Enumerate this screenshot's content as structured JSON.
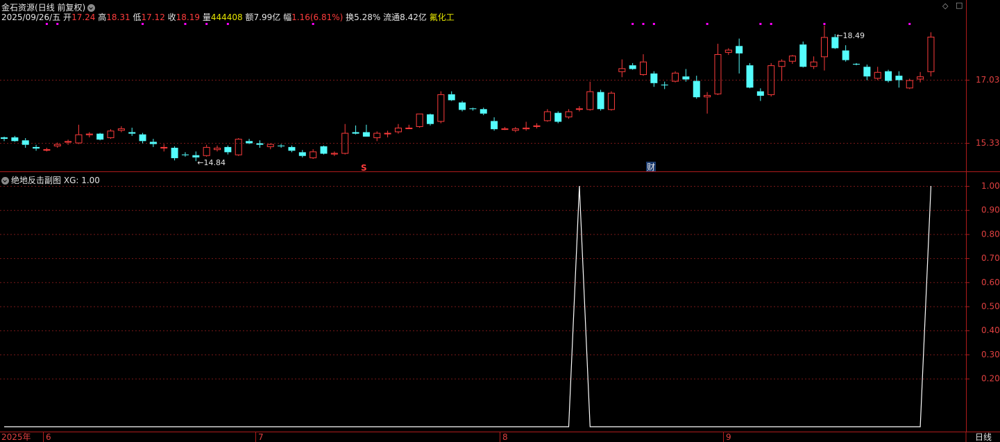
{
  "stock": {
    "name": "金石资源",
    "period": "(日线 前复权)",
    "date": "2025/09/26/五",
    "open_label": "开",
    "open": "17.24",
    "high_label": "高",
    "high": "18.31",
    "low_label": "低",
    "low": "17.12",
    "close_label": "收",
    "close": "18.19",
    "volume_label": "量",
    "volume": "444408",
    "amount_label": "额",
    "amount": "7.99亿",
    "change_label": "幅",
    "change": "1.16(6.81%)",
    "turnover_label": "换",
    "turnover": "5.28%",
    "float_label": "流通",
    "float": "8.42亿",
    "sector": "氟化工"
  },
  "window_buttons": {
    "diamond": "◇",
    "maximize": "□"
  },
  "indicator": {
    "name": "绝地反击副图",
    "xg_label": "XG: 1.00"
  },
  "markers": {
    "s_marker": "S",
    "cai_marker": "财"
  },
  "colors": {
    "up": "#ff3c3c",
    "down": "#54fcfc",
    "grid": "#7a1818",
    "axis": "#b01c1c",
    "indicator": "#ffffff",
    "dot": "#ff00ff"
  },
  "chart_data": [
    {
      "type": "candlestick",
      "grid": true,
      "y_ticks": [
        "17.03",
        "15.33"
      ],
      "x_ticks": [
        "2025年",
        "6",
        "7",
        "8",
        "9"
      ],
      "annotations": [
        {
          "text": "18.49",
          "candle_index": 78
        },
        {
          "text": "14.84",
          "candle_index": 18
        }
      ],
      "ohlc": [
        [
          15.48,
          15.5,
          15.38,
          15.44
        ],
        [
          15.48,
          15.52,
          15.36,
          15.38
        ],
        [
          15.4,
          15.46,
          15.2,
          15.28
        ],
        [
          15.22,
          15.28,
          15.12,
          15.18
        ],
        [
          15.14,
          15.2,
          15.1,
          15.16
        ],
        [
          15.24,
          15.34,
          15.2,
          15.3
        ],
        [
          15.34,
          15.42,
          15.28,
          15.38
        ],
        [
          15.32,
          15.82,
          15.3,
          15.56
        ],
        [
          15.54,
          15.62,
          15.48,
          15.58
        ],
        [
          15.58,
          15.6,
          15.4,
          15.42
        ],
        [
          15.46,
          15.7,
          15.44,
          15.66
        ],
        [
          15.66,
          15.78,
          15.62,
          15.72
        ],
        [
          15.62,
          15.74,
          15.52,
          15.58
        ],
        [
          15.56,
          15.6,
          15.32,
          15.38
        ],
        [
          15.36,
          15.44,
          15.22,
          15.3
        ],
        [
          15.22,
          15.3,
          15.1,
          15.22
        ],
        [
          15.2,
          15.24,
          14.86,
          14.92
        ],
        [
          15.02,
          15.08,
          14.96,
          15.0
        ],
        [
          15.0,
          15.1,
          14.84,
          14.94
        ],
        [
          14.98,
          15.28,
          14.96,
          15.22
        ],
        [
          15.14,
          15.26,
          15.1,
          15.2
        ],
        [
          15.22,
          15.26,
          15.02,
          15.08
        ],
        [
          15.0,
          15.46,
          14.98,
          15.44
        ],
        [
          15.38,
          15.44,
          15.3,
          15.32
        ],
        [
          15.32,
          15.4,
          15.2,
          15.28
        ],
        [
          15.22,
          15.32,
          15.16,
          15.3
        ],
        [
          15.26,
          15.3,
          15.2,
          15.24
        ],
        [
          15.22,
          15.26,
          15.08,
          15.12
        ],
        [
          15.08,
          15.14,
          14.94,
          14.98
        ],
        [
          14.92,
          15.16,
          14.9,
          15.1
        ],
        [
          15.24,
          15.26,
          15.02,
          15.04
        ],
        [
          15.02,
          15.1,
          14.98,
          15.06
        ],
        [
          15.04,
          15.84,
          15.02,
          15.6
        ],
        [
          15.62,
          15.8,
          15.56,
          15.58
        ],
        [
          15.62,
          15.82,
          15.5,
          15.5
        ],
        [
          15.46,
          15.64,
          15.38,
          15.6
        ],
        [
          15.58,
          15.66,
          15.48,
          15.6
        ],
        [
          15.62,
          15.84,
          15.58,
          15.74
        ],
        [
          15.74,
          15.82,
          15.72,
          15.74
        ],
        [
          15.76,
          16.12,
          15.74,
          16.12
        ],
        [
          16.1,
          16.12,
          15.8,
          15.84
        ],
        [
          15.9,
          16.72,
          15.86,
          16.64
        ],
        [
          16.64,
          16.72,
          16.46,
          16.48
        ],
        [
          16.42,
          16.46,
          16.18,
          16.22
        ],
        [
          16.26,
          16.28,
          16.2,
          16.24
        ],
        [
          16.24,
          16.28,
          16.08,
          16.12
        ],
        [
          15.92,
          16.02,
          15.66,
          15.7
        ],
        [
          15.7,
          15.76,
          15.68,
          15.72
        ],
        [
          15.66,
          15.76,
          15.62,
          15.72
        ],
        [
          15.7,
          15.9,
          15.66,
          15.74
        ],
        [
          15.78,
          15.86,
          15.72,
          15.8
        ],
        [
          15.92,
          16.24,
          15.9,
          16.18
        ],
        [
          16.14,
          16.18,
          15.86,
          15.9
        ],
        [
          16.02,
          16.24,
          15.98,
          16.18
        ],
        [
          16.24,
          16.32,
          16.18,
          16.26
        ],
        [
          16.22,
          16.98,
          16.2,
          16.72
        ],
        [
          16.7,
          16.76,
          16.2,
          16.24
        ],
        [
          16.22,
          16.72,
          16.2,
          16.68
        ],
        [
          17.24,
          17.58,
          17.1,
          17.34
        ],
        [
          17.42,
          17.48,
          17.3,
          17.32
        ],
        [
          17.16,
          17.72,
          17.14,
          17.52
        ],
        [
          17.2,
          17.26,
          16.84,
          16.94
        ],
        [
          16.9,
          16.98,
          16.78,
          16.88
        ],
        [
          16.98,
          17.26,
          16.96,
          17.22
        ],
        [
          17.12,
          17.32,
          16.98,
          17.04
        ],
        [
          17.0,
          17.14,
          16.52,
          16.56
        ],
        [
          16.56,
          16.7,
          16.12,
          16.62
        ],
        [
          16.64,
          18.0,
          16.62,
          17.72
        ],
        [
          17.76,
          17.88,
          17.7,
          17.84
        ],
        [
          17.94,
          18.14,
          17.2,
          17.74
        ],
        [
          17.42,
          17.48,
          16.8,
          16.82
        ],
        [
          16.72,
          16.8,
          16.46,
          16.6
        ],
        [
          16.62,
          17.48,
          16.58,
          17.42
        ],
        [
          17.38,
          17.58,
          17.0,
          17.54
        ],
        [
          17.52,
          17.7,
          17.46,
          17.68
        ],
        [
          17.98,
          18.06,
          17.36,
          17.38
        ],
        [
          17.38,
          17.66,
          17.32,
          17.52
        ],
        [
          17.64,
          18.49,
          17.28,
          18.18
        ],
        [
          18.18,
          18.26,
          17.86,
          17.88
        ],
        [
          17.82,
          17.96,
          17.52,
          17.56
        ],
        [
          17.46,
          17.48,
          17.42,
          17.44
        ],
        [
          17.38,
          17.44,
          17.02,
          17.12
        ],
        [
          17.06,
          17.38,
          17.02,
          17.24
        ],
        [
          17.26,
          17.3,
          16.96,
          17.0
        ],
        [
          17.14,
          17.26,
          16.82,
          17.02
        ],
        [
          16.8,
          17.06,
          16.78,
          17.02
        ],
        [
          17.04,
          17.24,
          16.96,
          17.12
        ],
        [
          17.24,
          18.31,
          17.12,
          18.19
        ]
      ]
    },
    {
      "type": "line",
      "series": [
        {
          "name": "XG",
          "values": [
            0,
            0,
            0,
            0,
            0,
            0,
            0,
            0,
            0,
            0,
            0,
            0,
            0,
            0,
            0,
            0,
            0,
            0,
            0,
            0,
            0,
            0,
            0,
            0,
            0,
            0,
            0,
            0,
            0,
            0,
            0,
            0,
            0,
            0,
            0,
            0,
            0,
            0,
            0,
            0,
            0,
            0,
            0,
            0,
            0,
            0,
            0,
            0,
            0,
            0,
            0,
            0,
            0,
            0,
            1,
            0,
            0,
            0,
            0,
            0,
            0,
            0,
            0,
            0,
            0,
            0,
            0,
            0,
            0,
            0,
            0,
            0,
            0,
            0,
            0,
            0,
            0,
            0,
            0,
            0,
            0,
            0,
            0,
            0,
            0,
            0,
            0,
            1
          ]
        }
      ],
      "y_ticks": [
        "1.00",
        "0.90",
        "0.80",
        "0.70",
        "0.60",
        "0.50",
        "0.40",
        "0.30",
        "0.20"
      ],
      "ylim": [
        0,
        1
      ],
      "bottom_label": "日线"
    }
  ]
}
